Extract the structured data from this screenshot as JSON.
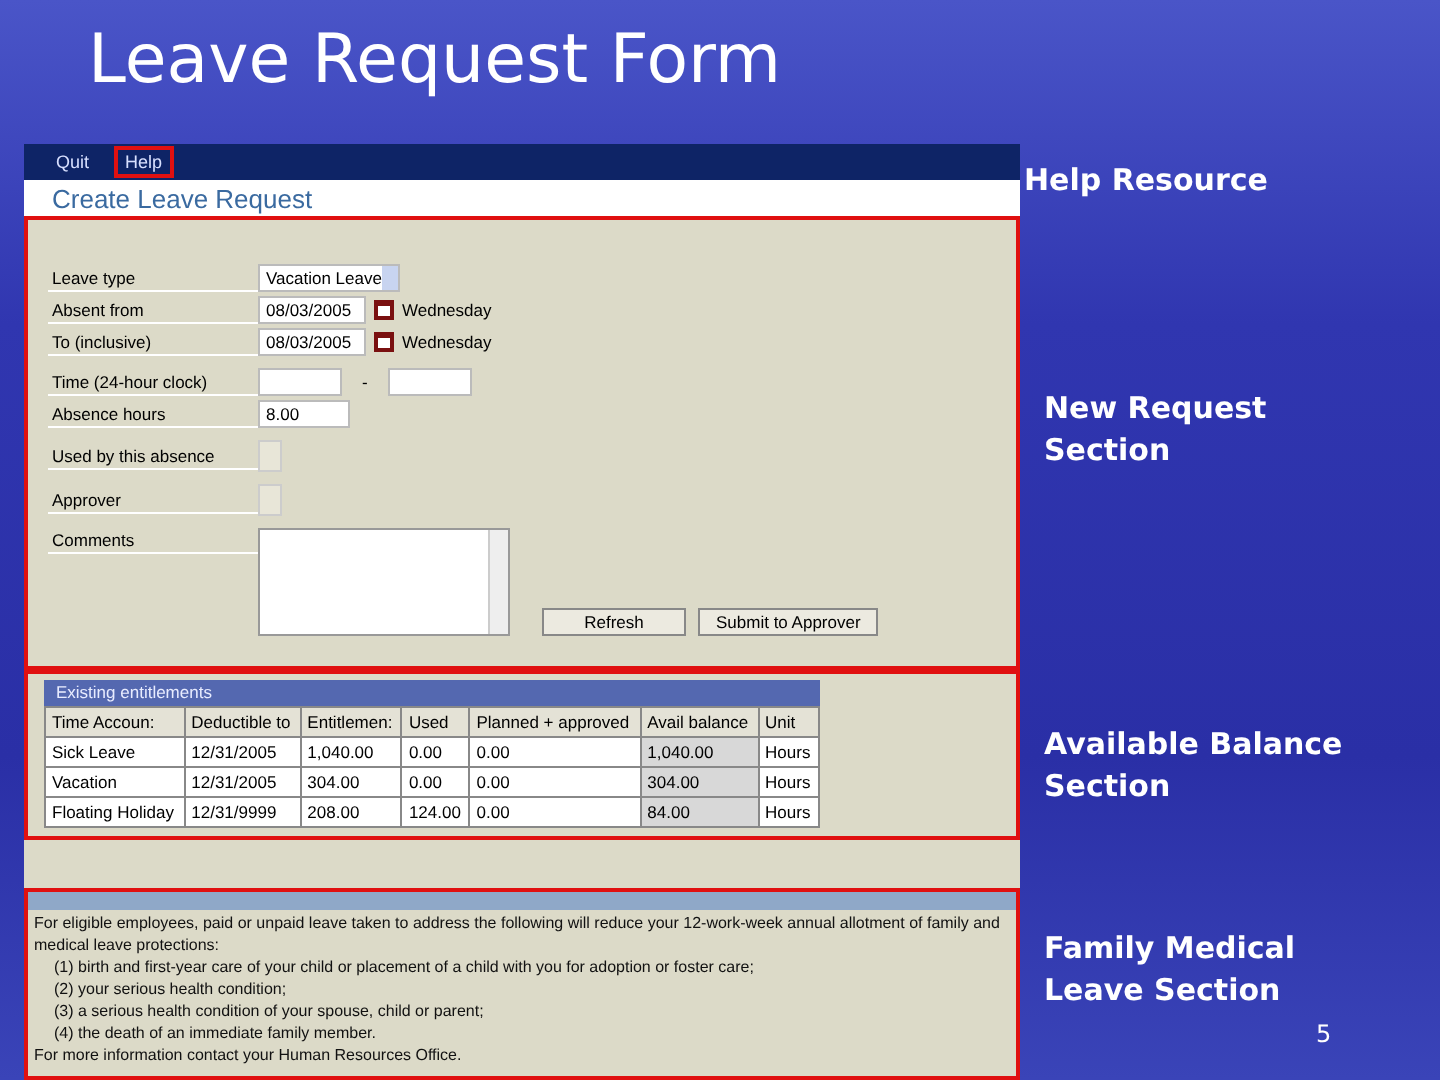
{
  "slide": {
    "title": "Leave Request Form",
    "page_number": "5"
  },
  "menu": [
    {
      "label": "Quit",
      "highlighted": false
    },
    {
      "label": "Help",
      "highlighted": true
    }
  ],
  "page_title": "Create Leave Request",
  "form": {
    "rows": [
      {
        "kind": "select",
        "label": "Leave type",
        "value": "Vacation Leave"
      },
      {
        "kind": "date",
        "label": "Absent from",
        "value": "08/03/2005",
        "weekday": "Wednesday"
      },
      {
        "kind": "date",
        "label": "To (inclusive)",
        "value": "08/03/2005",
        "weekday": "Wednesday"
      },
      {
        "kind": "time",
        "label": "Time (24-hour clock)",
        "separator": "-"
      },
      {
        "kind": "text",
        "label": "Absence hours",
        "value": "8.00"
      },
      {
        "kind": "readonly",
        "label": "Used by this absence"
      },
      {
        "kind": "readonly",
        "label": "Approver"
      },
      {
        "kind": "textarea",
        "label": "Comments"
      }
    ],
    "buttons": [
      "Refresh",
      "Submit to Approver"
    ]
  },
  "entitlements": {
    "title": "Existing entitlements",
    "columns": [
      "Time Accoun:",
      "Deductible to",
      "Entitlemen:",
      "Used",
      "Planned + approved",
      "Avail balance",
      "Unit"
    ],
    "rows": [
      [
        "Sick Leave",
        "12/31/2005",
        "1,040.00",
        "0.00",
        "0.00",
        "1,040.00",
        "Hours"
      ],
      [
        "Vacation",
        "12/31/2005",
        "304.00",
        "0.00",
        "0.00",
        "304.00",
        "Hours"
      ],
      [
        "Floating Holiday",
        "12/31/9999",
        "208.00",
        "124.00",
        "0.00",
        "84.00",
        "Hours"
      ]
    ]
  },
  "fmla": {
    "intro": "For eligible employees, paid or unpaid leave taken to address the following will reduce your 12-work-week annual allotment of family and medical leave protections:",
    "items": [
      "(1) birth and first-year care of your child or placement of a child with you for adoption or foster care;",
      "(2) your serious health condition;",
      "(3) a serious health condition of your spouse, child or parent;",
      "(4) the death of an immediate family member."
    ],
    "footer": "For more information contact your Human Resources Office."
  },
  "callouts": [
    "Help Resource",
    "New Request Section",
    "Available Balance Section",
    "Family Medical Leave Section"
  ]
}
